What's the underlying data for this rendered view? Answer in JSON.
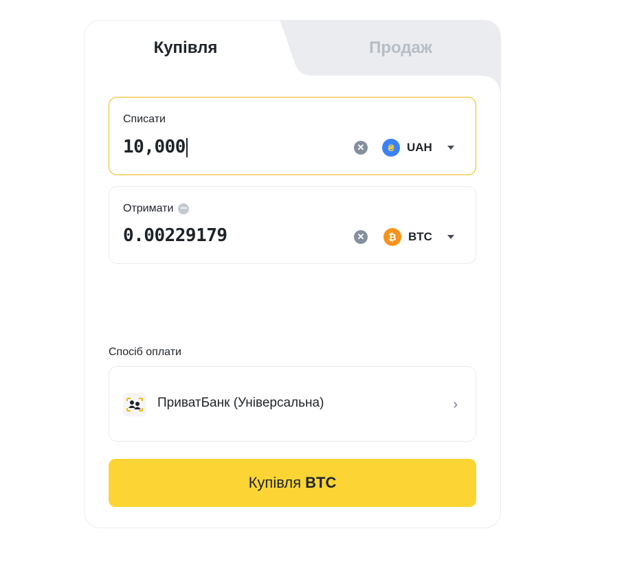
{
  "tabs": {
    "buy": "Купівля",
    "sell": "Продаж"
  },
  "spend": {
    "label": "Списати",
    "value": "10,000",
    "currency": "UAH",
    "currency_icon": "hryvnia-icon",
    "currency_color": "#3b82f6"
  },
  "receive": {
    "label": "Отримати",
    "value": "0.00229179",
    "currency": "BTC",
    "currency_icon": "bitcoin-icon",
    "currency_color": "#f7931a"
  },
  "payment": {
    "label": "Спосіб оплати",
    "method": "ПриватБанк (Універсальна)"
  },
  "action": {
    "prefix": "Купівля",
    "asset": "BTC"
  },
  "colors": {
    "accent": "#fcd535",
    "active_border": "#f0b90b"
  }
}
